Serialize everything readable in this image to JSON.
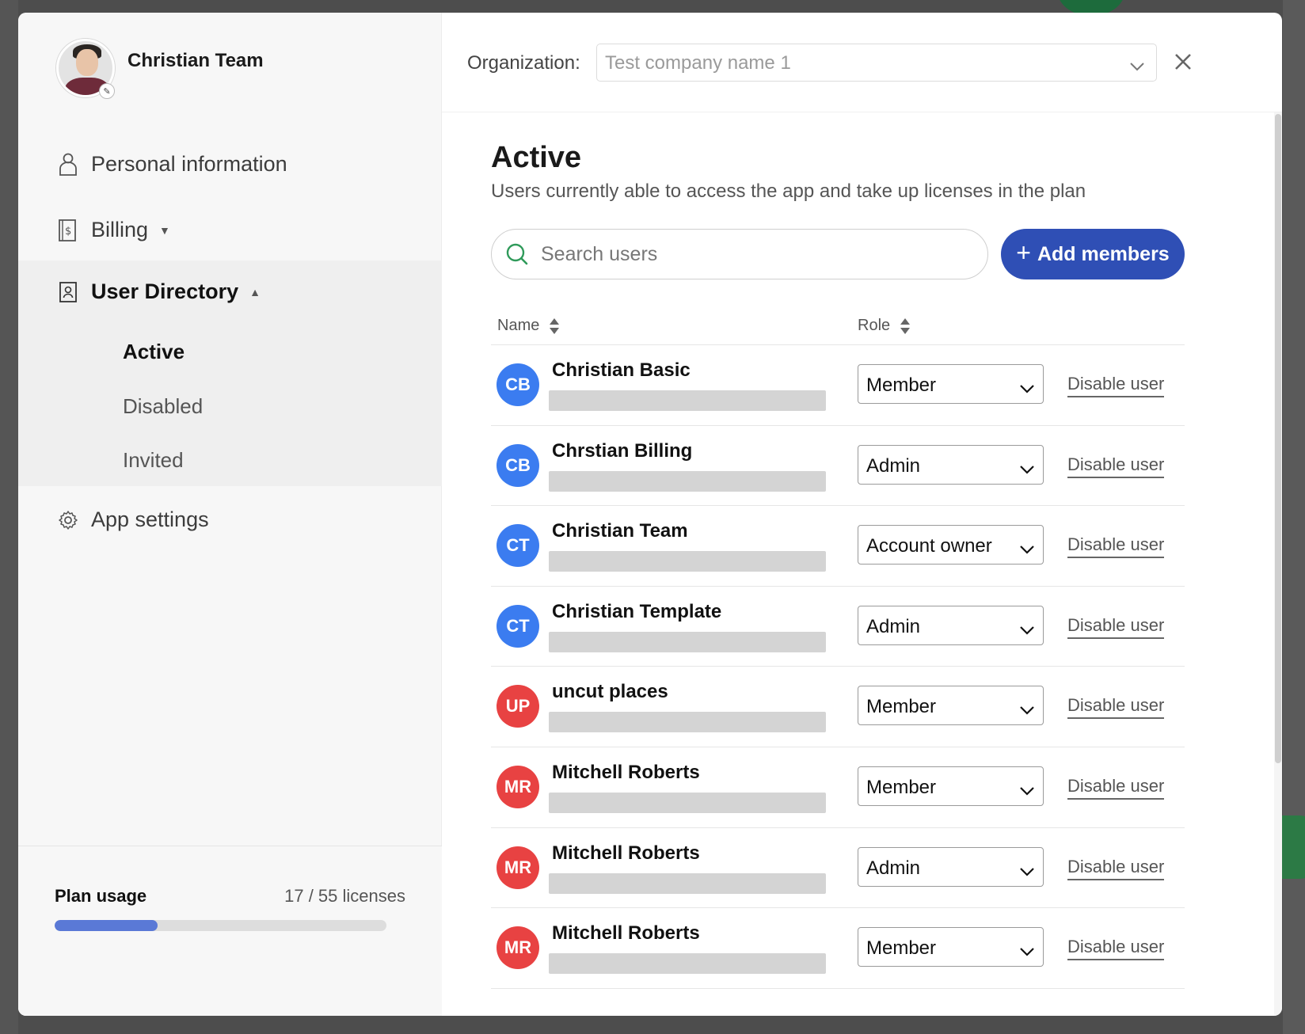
{
  "profile": {
    "name": "Christian Team",
    "avatar_icon": "user-photo",
    "edit_icon": "pencil-icon"
  },
  "nav": {
    "personal_information": "Personal information",
    "billing": "Billing",
    "user_directory": "User Directory",
    "sub": {
      "active": "Active",
      "disabled": "Disabled",
      "invited": "Invited"
    },
    "app_settings": "App settings"
  },
  "plan": {
    "label": "Plan usage",
    "count": "17 / 55 licenses",
    "used": 17,
    "total": 55
  },
  "topbar": {
    "org_label": "Organization:",
    "org_placeholder": "Test company name 1"
  },
  "section": {
    "title": "Active",
    "subtitle": "Users currently able to access the app and take up licenses in the plan"
  },
  "search": {
    "placeholder": "Search users"
  },
  "add_members": {
    "label": "Add members"
  },
  "table": {
    "col_name": "Name",
    "col_role": "Role",
    "disable_label": "Disable user",
    "rows": [
      {
        "initials": "CB",
        "name": "Christian Basic",
        "role": "Member",
        "color": "#3b7cf0"
      },
      {
        "initials": "CB",
        "name": "Chrstian Billing",
        "role": "Admin",
        "color": "#3b7cf0"
      },
      {
        "initials": "CT",
        "name": "Christian Team",
        "role": "Account owner",
        "color": "#3b7cf0"
      },
      {
        "initials": "CT",
        "name": "Christian Template",
        "role": "Admin",
        "color": "#3b7cf0"
      },
      {
        "initials": "UP",
        "name": "uncut places",
        "role": "Member",
        "color": "#e84242"
      },
      {
        "initials": "MR",
        "name": "Mitchell Roberts",
        "role": "Member",
        "color": "#e84242"
      },
      {
        "initials": "MR",
        "name": "Mitchell Roberts",
        "role": "Admin",
        "color": "#e84242"
      },
      {
        "initials": "MR",
        "name": "Mitchell Roberts",
        "role": "Member",
        "color": "#e84242"
      }
    ]
  },
  "colors": {
    "accent": "#2f4fb5",
    "progress": "#5a79d6"
  }
}
